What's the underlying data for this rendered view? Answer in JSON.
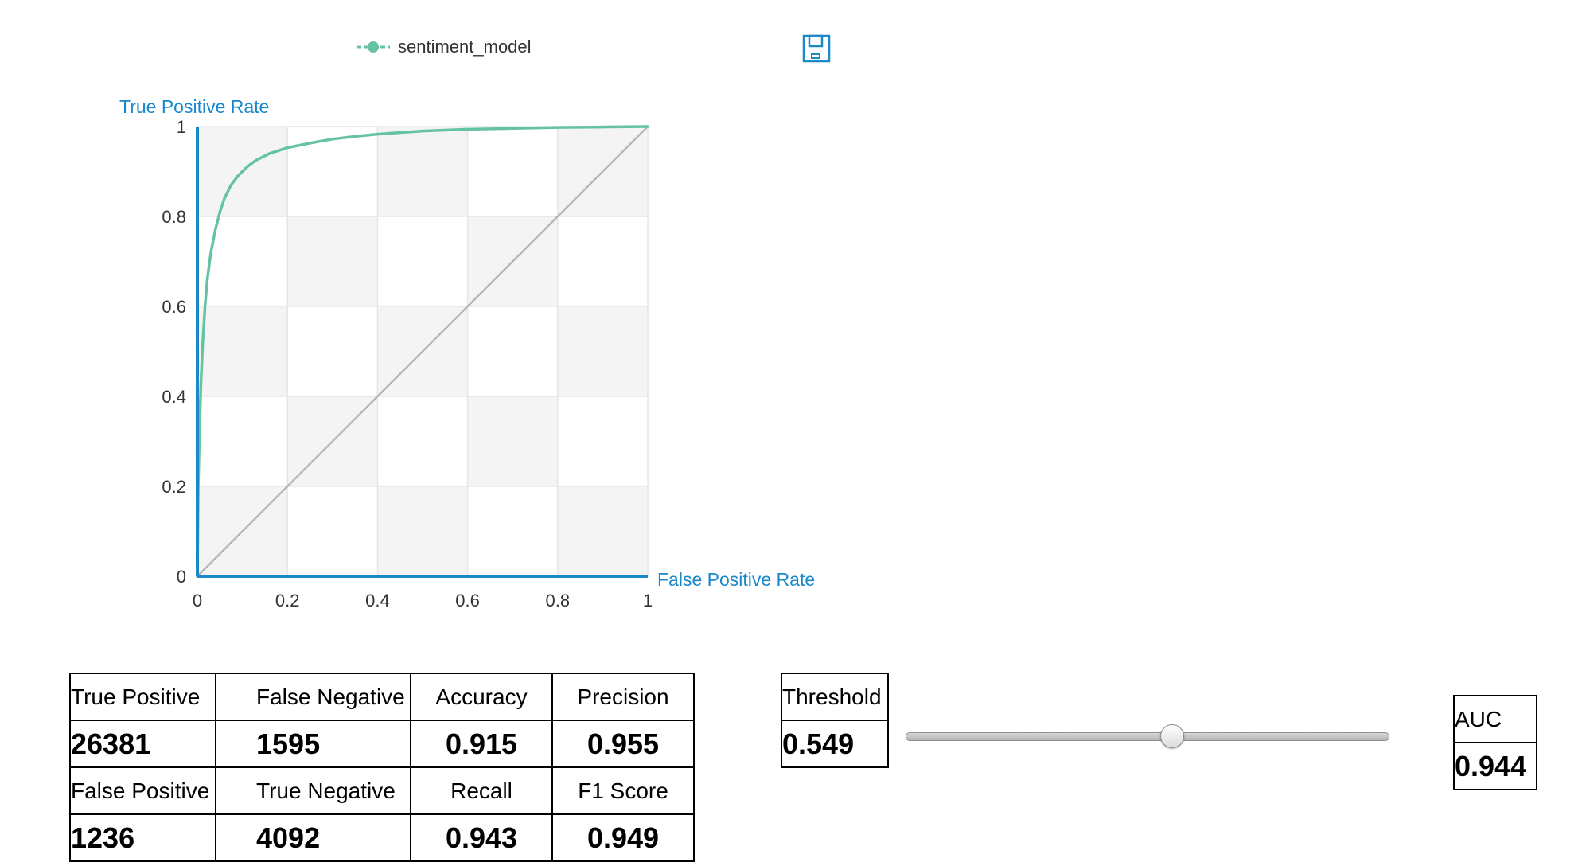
{
  "chart_data": {
    "type": "line",
    "title": "",
    "xlabel": "False Positive Rate",
    "ylabel": "True Positive Rate",
    "xlim": [
      0,
      1
    ],
    "ylim": [
      0,
      1
    ],
    "x_ticks": [
      "0",
      "0.2",
      "0.4",
      "0.6",
      "0.8",
      "1"
    ],
    "y_ticks": [
      "0",
      "0.2",
      "0.4",
      "0.6",
      "0.8",
      "1"
    ],
    "grid": true,
    "legend_position": "top-center",
    "series": [
      {
        "name": "sentiment_model",
        "color": "#66c2a5",
        "points": [
          [
            0,
            0
          ],
          [
            0.002,
            0.2
          ],
          [
            0.005,
            0.33
          ],
          [
            0.008,
            0.43
          ],
          [
            0.012,
            0.52
          ],
          [
            0.017,
            0.6
          ],
          [
            0.022,
            0.66
          ],
          [
            0.03,
            0.72
          ],
          [
            0.04,
            0.77
          ],
          [
            0.05,
            0.81
          ],
          [
            0.06,
            0.84
          ],
          [
            0.075,
            0.87
          ],
          [
            0.09,
            0.89
          ],
          [
            0.11,
            0.91
          ],
          [
            0.13,
            0.925
          ],
          [
            0.16,
            0.94
          ],
          [
            0.2,
            0.953
          ],
          [
            0.25,
            0.963
          ],
          [
            0.3,
            0.972
          ],
          [
            0.35,
            0.978
          ],
          [
            0.4,
            0.983
          ],
          [
            0.5,
            0.99
          ],
          [
            0.6,
            0.994
          ],
          [
            0.7,
            0.996
          ],
          [
            0.8,
            0.998
          ],
          [
            0.9,
            0.999
          ],
          [
            1,
            1
          ]
        ]
      },
      {
        "name": "",
        "color": "#b7b7b7",
        "points": [
          [
            0,
            0
          ],
          [
            1,
            1
          ]
        ]
      }
    ]
  },
  "colors": {
    "axis": "#1a88c9",
    "grid": "#e6e6e6",
    "band": "#f4f4f4"
  },
  "legend": {
    "label": "sentiment_model"
  },
  "icons": {
    "save": "save-icon"
  },
  "metrics": {
    "true_positive": {
      "label": "True Positive",
      "value": "26381"
    },
    "false_negative": {
      "label": "False Negative",
      "value": "1595"
    },
    "accuracy": {
      "label": "Accuracy",
      "value": "0.915"
    },
    "precision": {
      "label": "Precision",
      "value": "0.955"
    },
    "false_positive": {
      "label": "False Positive",
      "value": "1236"
    },
    "true_negative": {
      "label": "True Negative",
      "value": "4092"
    },
    "recall": {
      "label": "Recall",
      "value": "0.943"
    },
    "f1_score": {
      "label": "F1 Score",
      "value": "0.949"
    }
  },
  "threshold": {
    "label": "Threshold",
    "value": "0.549",
    "fraction": 0.549
  },
  "auc": {
    "label": "AUC",
    "value": "0.944"
  }
}
